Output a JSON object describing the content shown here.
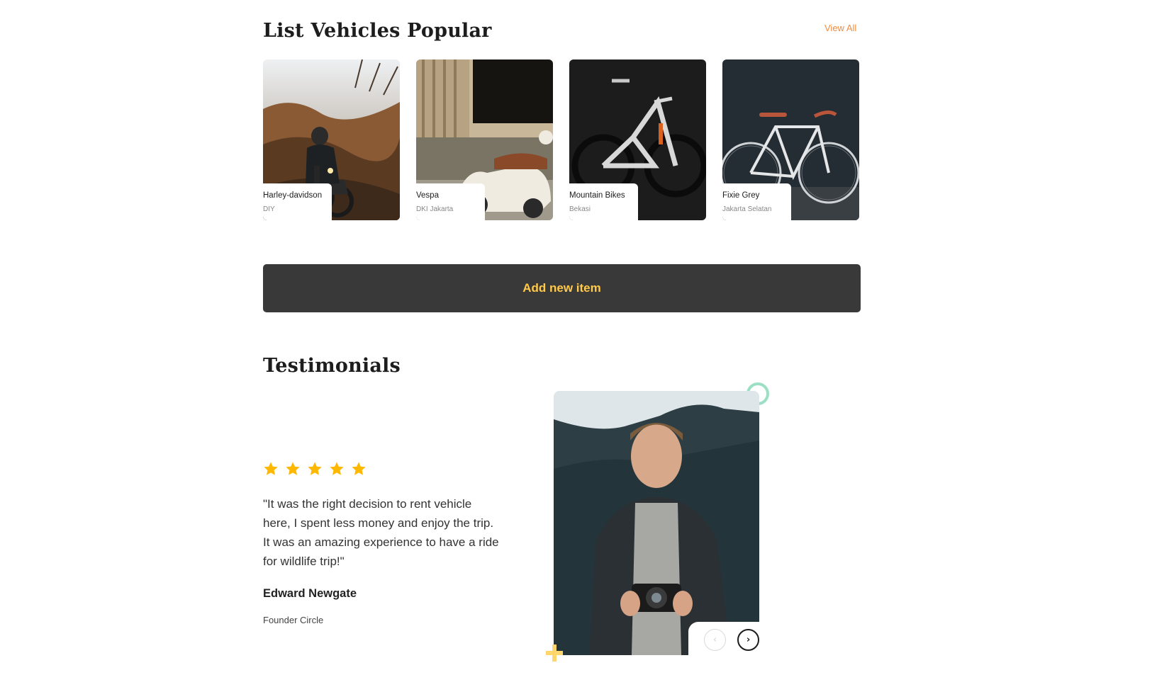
{
  "popular": {
    "title": "List Vehicles Popular",
    "view_all_label": "View All",
    "vehicles": [
      {
        "name": "Harley-davidson",
        "location": "DIY"
      },
      {
        "name": "Vespa",
        "location": "DKI Jakarta"
      },
      {
        "name": "Mountain Bikes",
        "location": "Bekasi"
      },
      {
        "name": "Fixie Grey",
        "location": "Jakarta Selatan"
      }
    ]
  },
  "add_item": {
    "label": "Add new item"
  },
  "testimonials": {
    "title": "Testimonials",
    "rating": 5,
    "quote": "\"It was the right decision to rent vehicle here, I spent less money and enjoy the trip. It was an amazing experience to have a ride for wildlife trip!\"",
    "author": "Edward Newgate",
    "role": "Founder Circle",
    "prev_icon": "chevron-left-icon",
    "next_icon": "chevron-right-icon"
  },
  "colors": {
    "accent_orange": "#f28c3f",
    "star_yellow": "#ffb800",
    "button_bg": "#393939",
    "button_text": "#ffc94b",
    "ring_green": "#9be0c4",
    "plus_yellow": "#ffd66b"
  }
}
